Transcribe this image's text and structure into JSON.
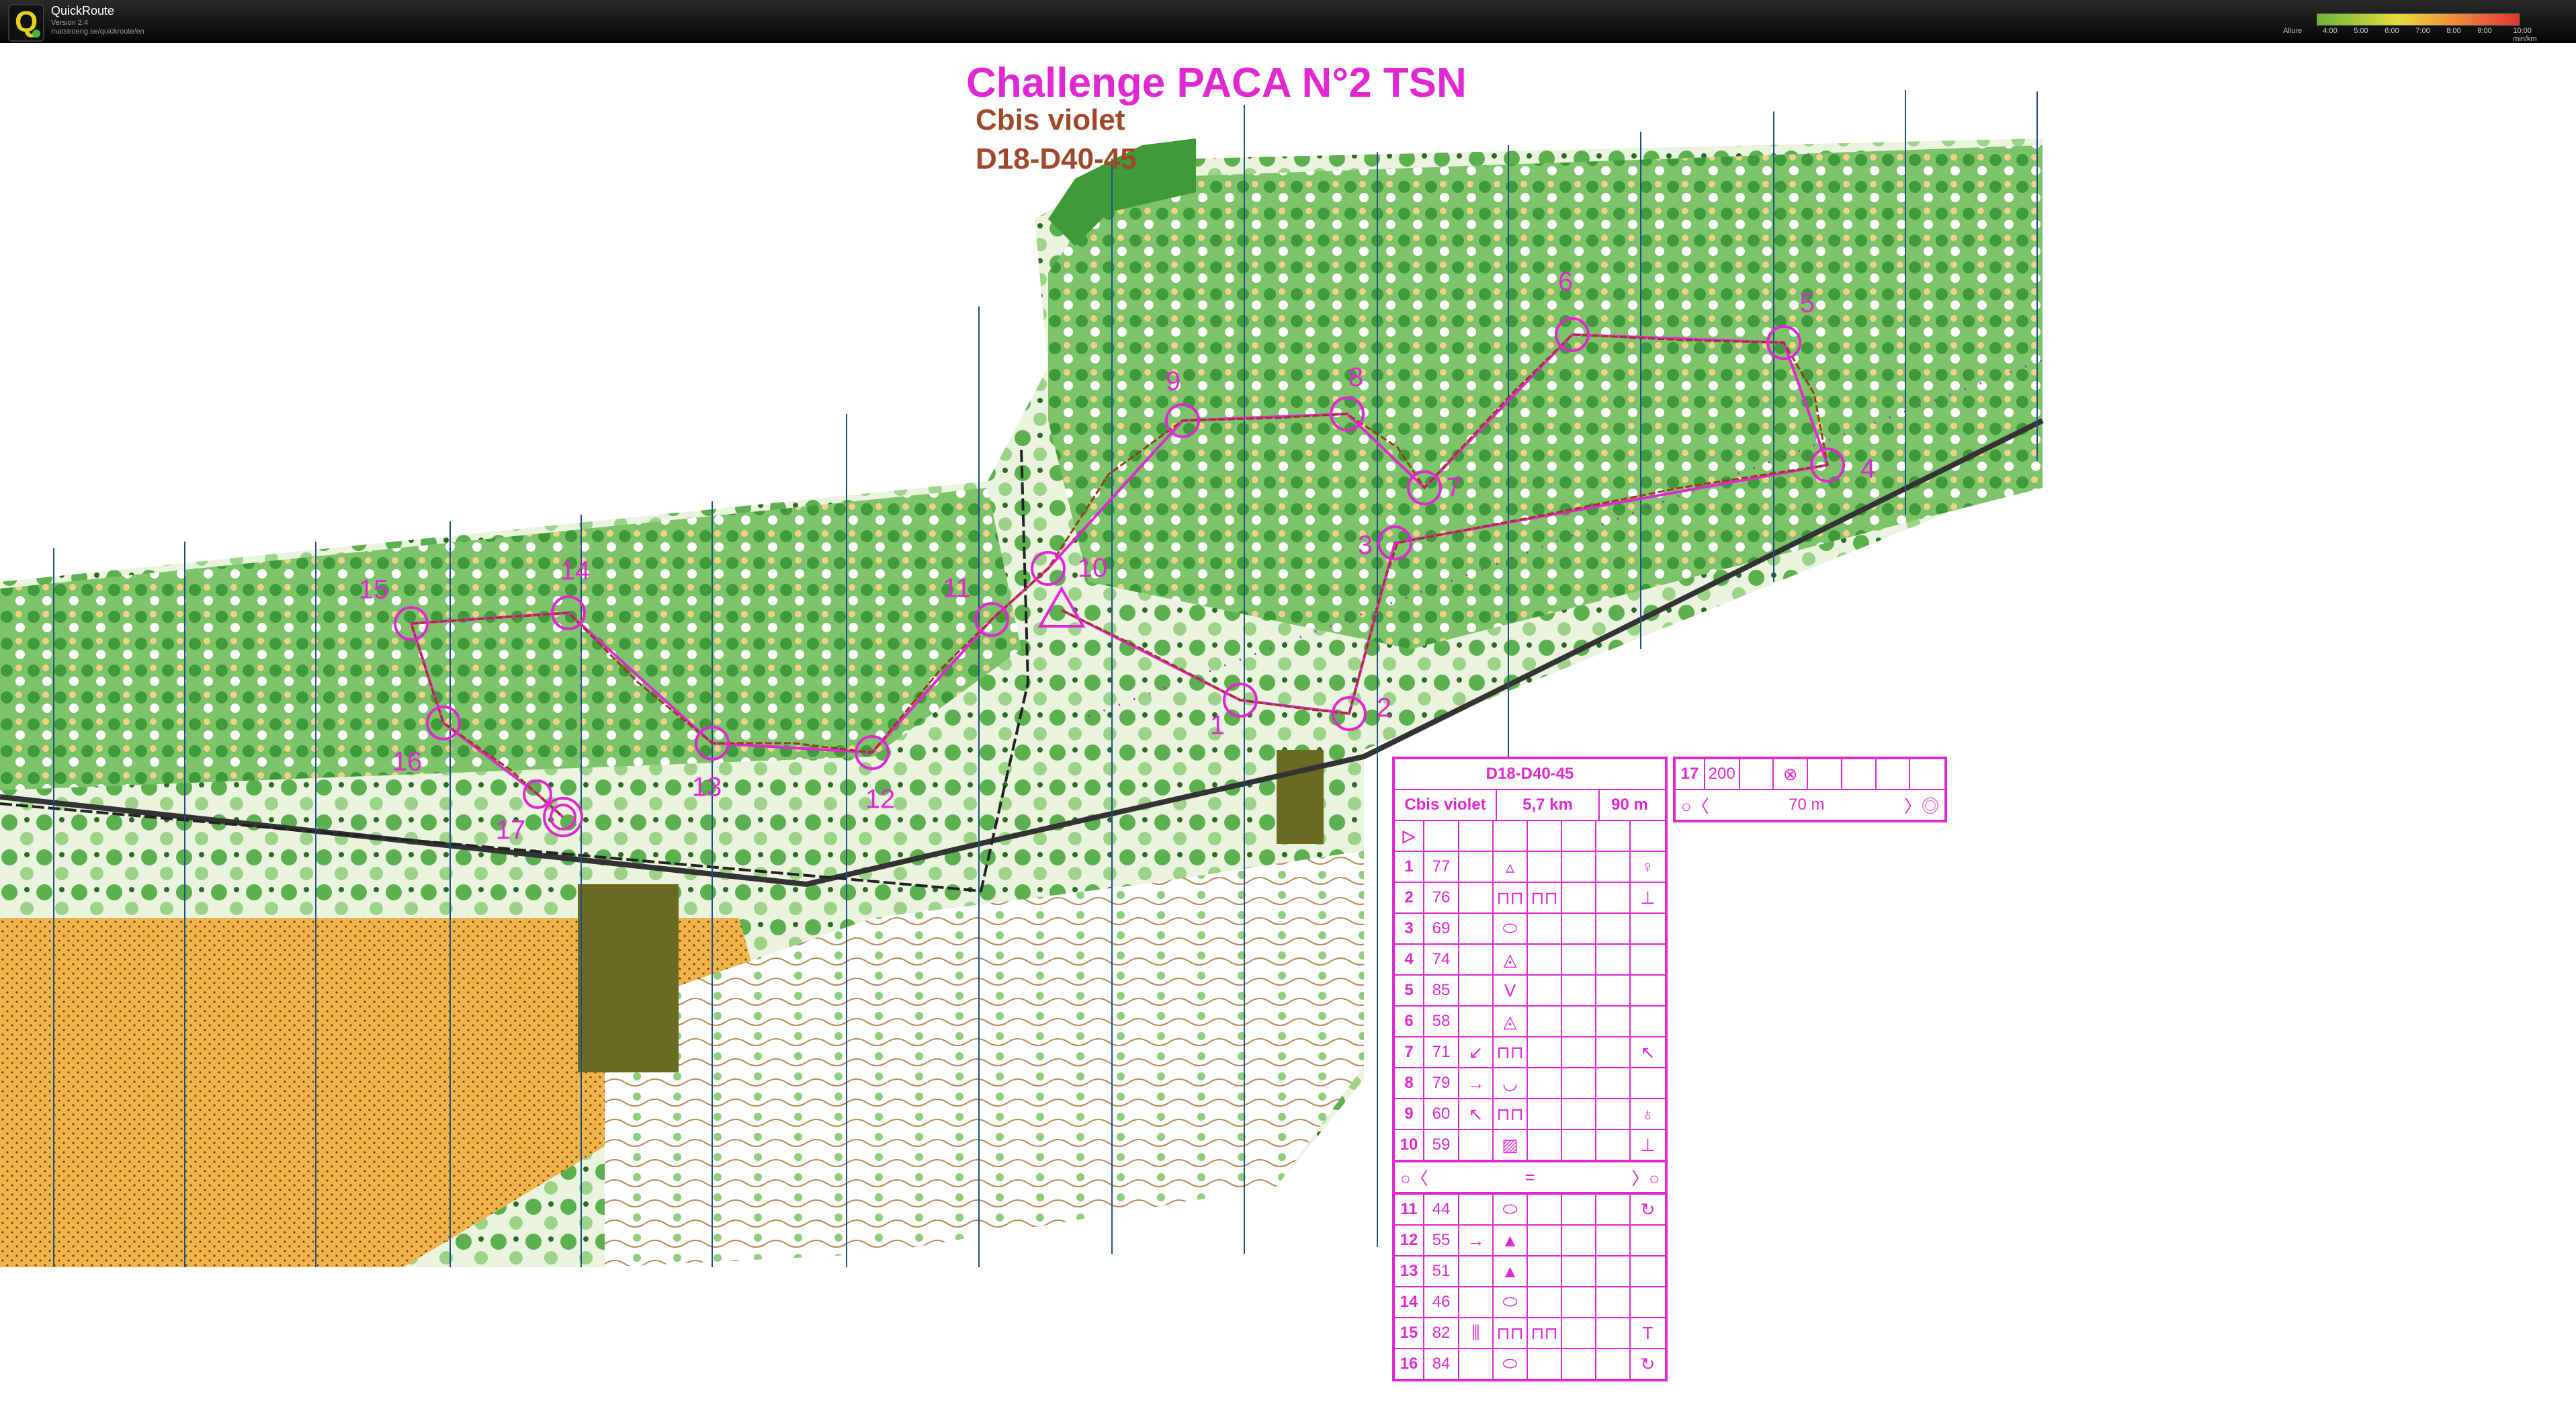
{
  "app": {
    "name": "QuickRoute",
    "version": "Version 2.4",
    "url": "matstroeng.se/quickroute/en",
    "icon": "quickroute-logo-icon"
  },
  "pace_legend": {
    "label": "Allure",
    "ticks": [
      "4:00",
      "5:00",
      "6:00",
      "7:00",
      "8:00",
      "9:00",
      "10:00 min/km"
    ],
    "colors": [
      "#6cb23a",
      "#a9c83a",
      "#e5dc3a",
      "#f0a43a",
      "#ea6a3a",
      "#e2342f"
    ]
  },
  "map": {
    "title": "Challenge PACA N°2 TSN",
    "subtitle_course": "Cbis violet",
    "subtitle_category": "D18-D40-45",
    "course_color": "#e127d3",
    "control_labels": [
      "1",
      "2",
      "3",
      "4",
      "5",
      "6",
      "7",
      "8",
      "9",
      "10",
      "11",
      "12",
      "13",
      "14",
      "15",
      "16",
      "17"
    ]
  },
  "description_sheet": {
    "header": "D18-D40-45",
    "course": "Cbis violet",
    "length": "5,7 km",
    "climb": "90 m",
    "start_symbol": "start-triangle-icon",
    "controls": [
      {
        "num": "1",
        "code": "77",
        "d": "",
        "e": "▵",
        "f": "",
        "g": "",
        "h": "",
        "i": "♀"
      },
      {
        "num": "2",
        "code": "76",
        "d": "",
        "e": "⊓⊓",
        "f": "⊓⊓",
        "g": "",
        "h": "",
        "i": "⊥"
      },
      {
        "num": "3",
        "code": "69",
        "d": "",
        "e": "⬭",
        "f": "",
        "g": "",
        "h": "",
        "i": ""
      },
      {
        "num": "4",
        "code": "74",
        "d": "",
        "e": "◬",
        "f": "",
        "g": "",
        "h": "",
        "i": ""
      },
      {
        "num": "5",
        "code": "85",
        "d": "",
        "e": "V",
        "f": "",
        "g": "",
        "h": "",
        "i": ""
      },
      {
        "num": "6",
        "code": "58",
        "d": "",
        "e": "◬",
        "f": "",
        "g": "",
        "h": "",
        "i": ""
      },
      {
        "num": "7",
        "code": "71",
        "d": "↙",
        "e": "⊓⊓",
        "f": "",
        "g": "",
        "h": "",
        "i": "↖"
      },
      {
        "num": "8",
        "code": "79",
        "d": "→",
        "e": "◡",
        "f": "",
        "g": "",
        "h": "",
        "i": ""
      },
      {
        "num": "9",
        "code": "60",
        "d": "↖",
        "e": "⊓⊓",
        "f": "",
        "g": "",
        "h": "",
        "i": "♁"
      },
      {
        "num": "10",
        "code": "59",
        "d": "",
        "e": "▨",
        "f": "",
        "g": "",
        "h": "",
        "i": "⊥"
      }
    ],
    "marked_route": "=",
    "controls_b": [
      {
        "num": "11",
        "code": "44",
        "d": "",
        "e": "⬭",
        "f": "",
        "g": "",
        "h": "",
        "i": "↻"
      },
      {
        "num": "12",
        "code": "55",
        "d": "→",
        "e": "▲",
        "f": "",
        "g": "",
        "h": "",
        "i": ""
      },
      {
        "num": "13",
        "code": "51",
        "d": "",
        "e": "▲",
        "f": "",
        "g": "",
        "h": "",
        "i": ""
      },
      {
        "num": "14",
        "code": "46",
        "d": "",
        "e": "⬭",
        "f": "",
        "g": "",
        "h": "",
        "i": ""
      },
      {
        "num": "15",
        "code": "82",
        "d": "⫼",
        "e": "⊓⊓",
        "f": "⊓⊓",
        "g": "",
        "h": "",
        "i": "T"
      },
      {
        "num": "16",
        "code": "84",
        "d": "",
        "e": "⬭",
        "f": "",
        "g": "",
        "h": "",
        "i": "↻"
      }
    ]
  },
  "finish_box": {
    "num": "17",
    "code": "200",
    "symbol": "⊗",
    "finish_distance": "70 m"
  }
}
